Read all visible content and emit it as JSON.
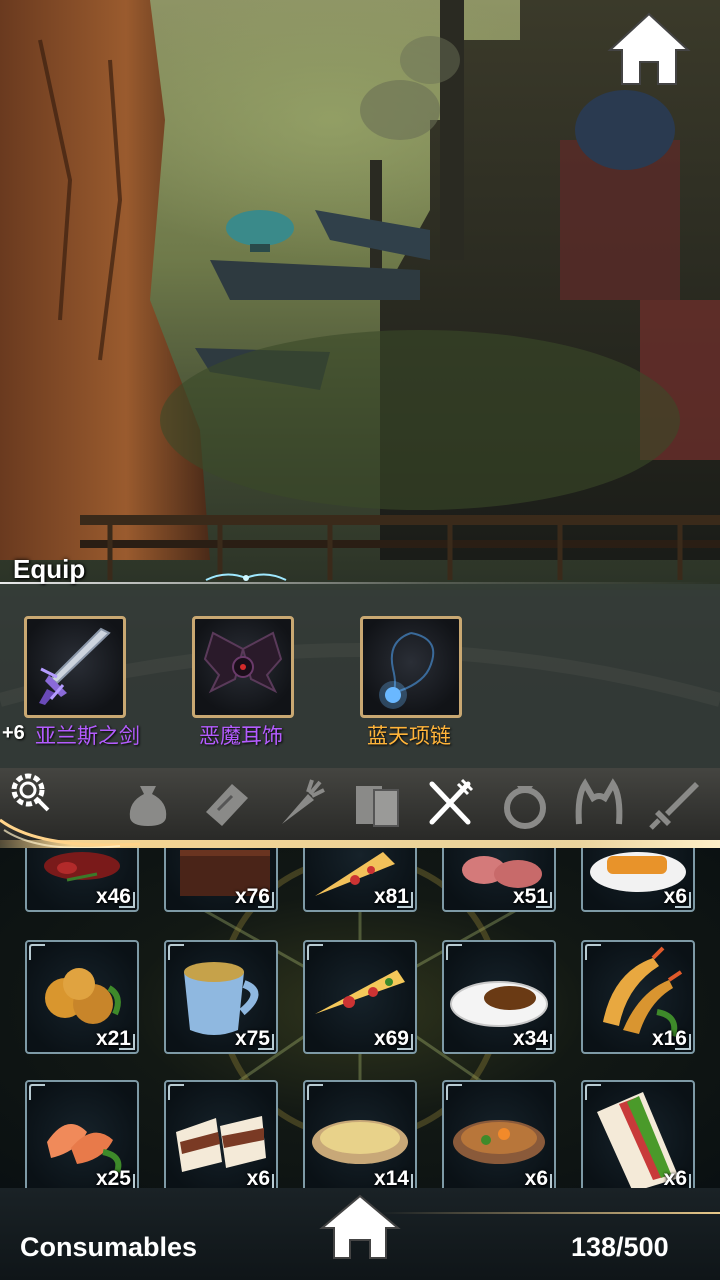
{
  "equip": {
    "title": "Equip",
    "plus_level": "+6",
    "slots": [
      {
        "name": "亚兰斯之剑",
        "color": "#b45cff",
        "icon": "sword-icon"
      },
      {
        "name": "恶魔耳饰",
        "color": "#b45cff",
        "icon": "demon-wing-earring-icon"
      },
      {
        "name": "蓝天项链",
        "color": "#ffb43a",
        "icon": "blue-necklace-icon"
      }
    ]
  },
  "tabs": [
    {
      "icon": "bag-icon",
      "active": false
    },
    {
      "icon": "scroll-icon",
      "active": false
    },
    {
      "icon": "carrot-icon",
      "active": false
    },
    {
      "icon": "book-icon",
      "active": false
    },
    {
      "icon": "fork-knife-icon",
      "active": true
    },
    {
      "icon": "ring-icon",
      "active": false
    },
    {
      "icon": "cat-ears-icon",
      "active": false
    },
    {
      "icon": "sword-icon",
      "active": false
    }
  ],
  "inventory": {
    "rows": [
      [
        {
          "qty": "x46",
          "icon": "meat-icon"
        },
        {
          "qty": "x76",
          "icon": "chocolate-cake-icon"
        },
        {
          "qty": "x81",
          "icon": "pizza-slice-icon"
        },
        {
          "qty": "x51",
          "icon": "ham-icon"
        },
        {
          "qty": "x6",
          "icon": "katsu-curry-icon"
        }
      ],
      [
        {
          "qty": "x21",
          "icon": "fried-chicken-icon"
        },
        {
          "qty": "x75",
          "icon": "corn-soup-cup-icon"
        },
        {
          "qty": "x69",
          "icon": "pizza-slice-icon"
        },
        {
          "qty": "x34",
          "icon": "curry-rice-icon"
        },
        {
          "qty": "x16",
          "icon": "fried-shrimp-icon"
        }
      ],
      [
        {
          "qty": "x25",
          "icon": "salmon-icon"
        },
        {
          "qty": "x6",
          "icon": "sandwich-icon"
        },
        {
          "qty": "x14",
          "icon": "cream-soup-icon"
        },
        {
          "qty": "x6",
          "icon": "stew-icon"
        },
        {
          "qty": "x6",
          "icon": "club-sandwich-icon"
        }
      ]
    ]
  },
  "footer": {
    "category_label": "Consumables",
    "capacity": "138/500"
  }
}
